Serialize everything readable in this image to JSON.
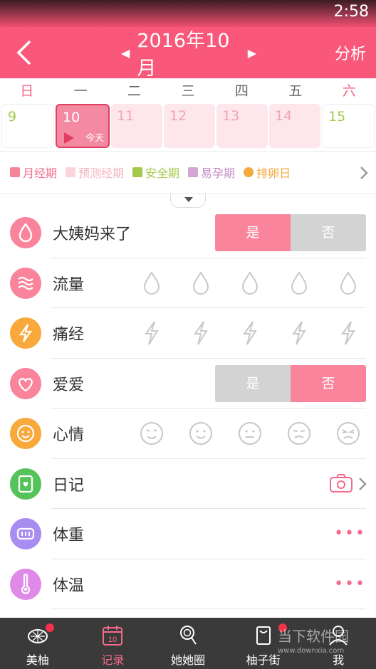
{
  "status": {
    "time": "2:58"
  },
  "header": {
    "back_icon": "chevron-left-icon",
    "prev_icon": "triangle-left-icon",
    "month": "2016年10月",
    "next_icon": "triangle-right-icon",
    "analysis": "分析"
  },
  "weekdays": [
    "日",
    "一",
    "二",
    "三",
    "四",
    "五",
    "六"
  ],
  "days": [
    {
      "num": "9",
      "type": "safe"
    },
    {
      "num": "10",
      "type": "today",
      "label": "今天"
    },
    {
      "num": "11",
      "type": "pred"
    },
    {
      "num": "12",
      "type": "pred"
    },
    {
      "num": "13",
      "type": "pred"
    },
    {
      "num": "14",
      "type": "pred"
    },
    {
      "num": "15",
      "type": "safe"
    }
  ],
  "legend": [
    {
      "label": "月经期",
      "color": "#f6839b"
    },
    {
      "label": "预测经期",
      "color": "#fcd3dc"
    },
    {
      "label": "安全期",
      "color": "#a6c84b"
    },
    {
      "label": "易孕期",
      "color": "#d3a6d3"
    },
    {
      "label": "排卵日",
      "color": "#f3a93c"
    }
  ],
  "rows": {
    "period": {
      "label": "大姨妈来了",
      "yes": "是",
      "no": "否",
      "selected": "yes",
      "icon": "drop-icon",
      "color": "#f9849b"
    },
    "flow": {
      "label": "流量",
      "icon": "waves-icon",
      "color": "#f9849b"
    },
    "pain": {
      "label": "痛经",
      "icon": "lightning-icon",
      "color": "#f9a93c"
    },
    "love": {
      "label": "爱爱",
      "yes": "是",
      "no": "否",
      "selected": "no",
      "icon": "heart-icon",
      "color": "#f9849b"
    },
    "mood": {
      "label": "心情",
      "icon": "smile-icon",
      "color": "#f9a93c"
    },
    "diary": {
      "label": "日记",
      "icon": "notebook-icon",
      "color": "#55c35a"
    },
    "weight": {
      "label": "体重",
      "icon": "scale-icon",
      "color": "#a98cf0",
      "more": "•••"
    },
    "temp": {
      "label": "体温",
      "icon": "thermometer-icon",
      "color": "#e08ae8",
      "more": "•••"
    }
  },
  "tabs": [
    {
      "label": "美柚",
      "icon": "grapefruit-icon",
      "badge": true
    },
    {
      "label": "记录",
      "icon": "calendar-icon",
      "active": true
    },
    {
      "label": "她她圈",
      "icon": "lollipop-icon"
    },
    {
      "label": "柚子街",
      "icon": "shop-icon",
      "badge": true
    },
    {
      "label": "我",
      "icon": "person-icon"
    }
  ],
  "watermark": {
    "text": "当下软件园",
    "url": "www.downxia.com"
  }
}
